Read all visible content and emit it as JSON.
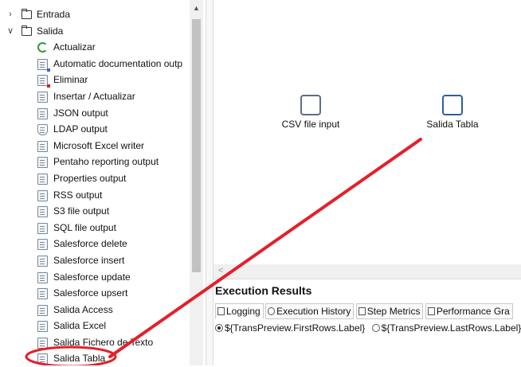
{
  "tree": {
    "items": [
      {
        "label": "Entrada",
        "level": 0,
        "expanded": false,
        "icon": "folder-icon"
      },
      {
        "label": "Salida",
        "level": 0,
        "expanded": true,
        "icon": "folder-icon"
      },
      {
        "label": "Actualizar",
        "level": 1,
        "icon": "refresh-icon"
      },
      {
        "label": "Automatic documentation outp",
        "level": 1,
        "icon": "doc-icon"
      },
      {
        "label": "Eliminar",
        "level": 1,
        "icon": "delete-icon"
      },
      {
        "label": "Insertar / Actualizar",
        "level": 1,
        "icon": "insert-update-icon"
      },
      {
        "label": "JSON output",
        "level": 1,
        "icon": "json-icon"
      },
      {
        "label": "LDAP output",
        "level": 1,
        "icon": "ldap-icon"
      },
      {
        "label": "Microsoft Excel writer",
        "level": 1,
        "icon": "excel-icon"
      },
      {
        "label": "Pentaho reporting output",
        "level": 1,
        "icon": "report-icon"
      },
      {
        "label": "Properties output",
        "level": 1,
        "icon": "properties-icon"
      },
      {
        "label": "RSS output",
        "level": 1,
        "icon": "rss-icon"
      },
      {
        "label": "S3 file output",
        "level": 1,
        "icon": "s3-icon"
      },
      {
        "label": "SQL file output",
        "level": 1,
        "icon": "sql-icon"
      },
      {
        "label": "Salesforce delete",
        "level": 1,
        "icon": "salesforce-delete-icon"
      },
      {
        "label": "Salesforce insert",
        "level": 1,
        "icon": "salesforce-insert-icon"
      },
      {
        "label": "Salesforce update",
        "level": 1,
        "icon": "salesforce-update-icon"
      },
      {
        "label": "Salesforce upsert",
        "level": 1,
        "icon": "salesforce-upsert-icon"
      },
      {
        "label": "Salida Access",
        "level": 1,
        "icon": "access-icon"
      },
      {
        "label": "Salida Excel",
        "level": 1,
        "icon": "excel-icon"
      },
      {
        "label": "Salida Fichero de Texto",
        "level": 1,
        "icon": "text-file-icon"
      },
      {
        "label": "Salida Tabla",
        "level": 1,
        "icon": "table-icon"
      }
    ]
  },
  "canvas": {
    "steps": [
      {
        "label": "CSV file input",
        "icon": "csv-file-icon"
      },
      {
        "label": "Salida Tabla",
        "icon": "table-output-icon"
      }
    ]
  },
  "results": {
    "title": "Execution Results",
    "tabs": [
      "Logging",
      "Execution History",
      "Step Metrics",
      "Performance Gra"
    ],
    "radio_first": "${TransPreview.FirstRows.Label}",
    "radio_last": "${TransPreview.LastRows.Label}"
  },
  "annotation": {
    "color": "#e3202a"
  }
}
